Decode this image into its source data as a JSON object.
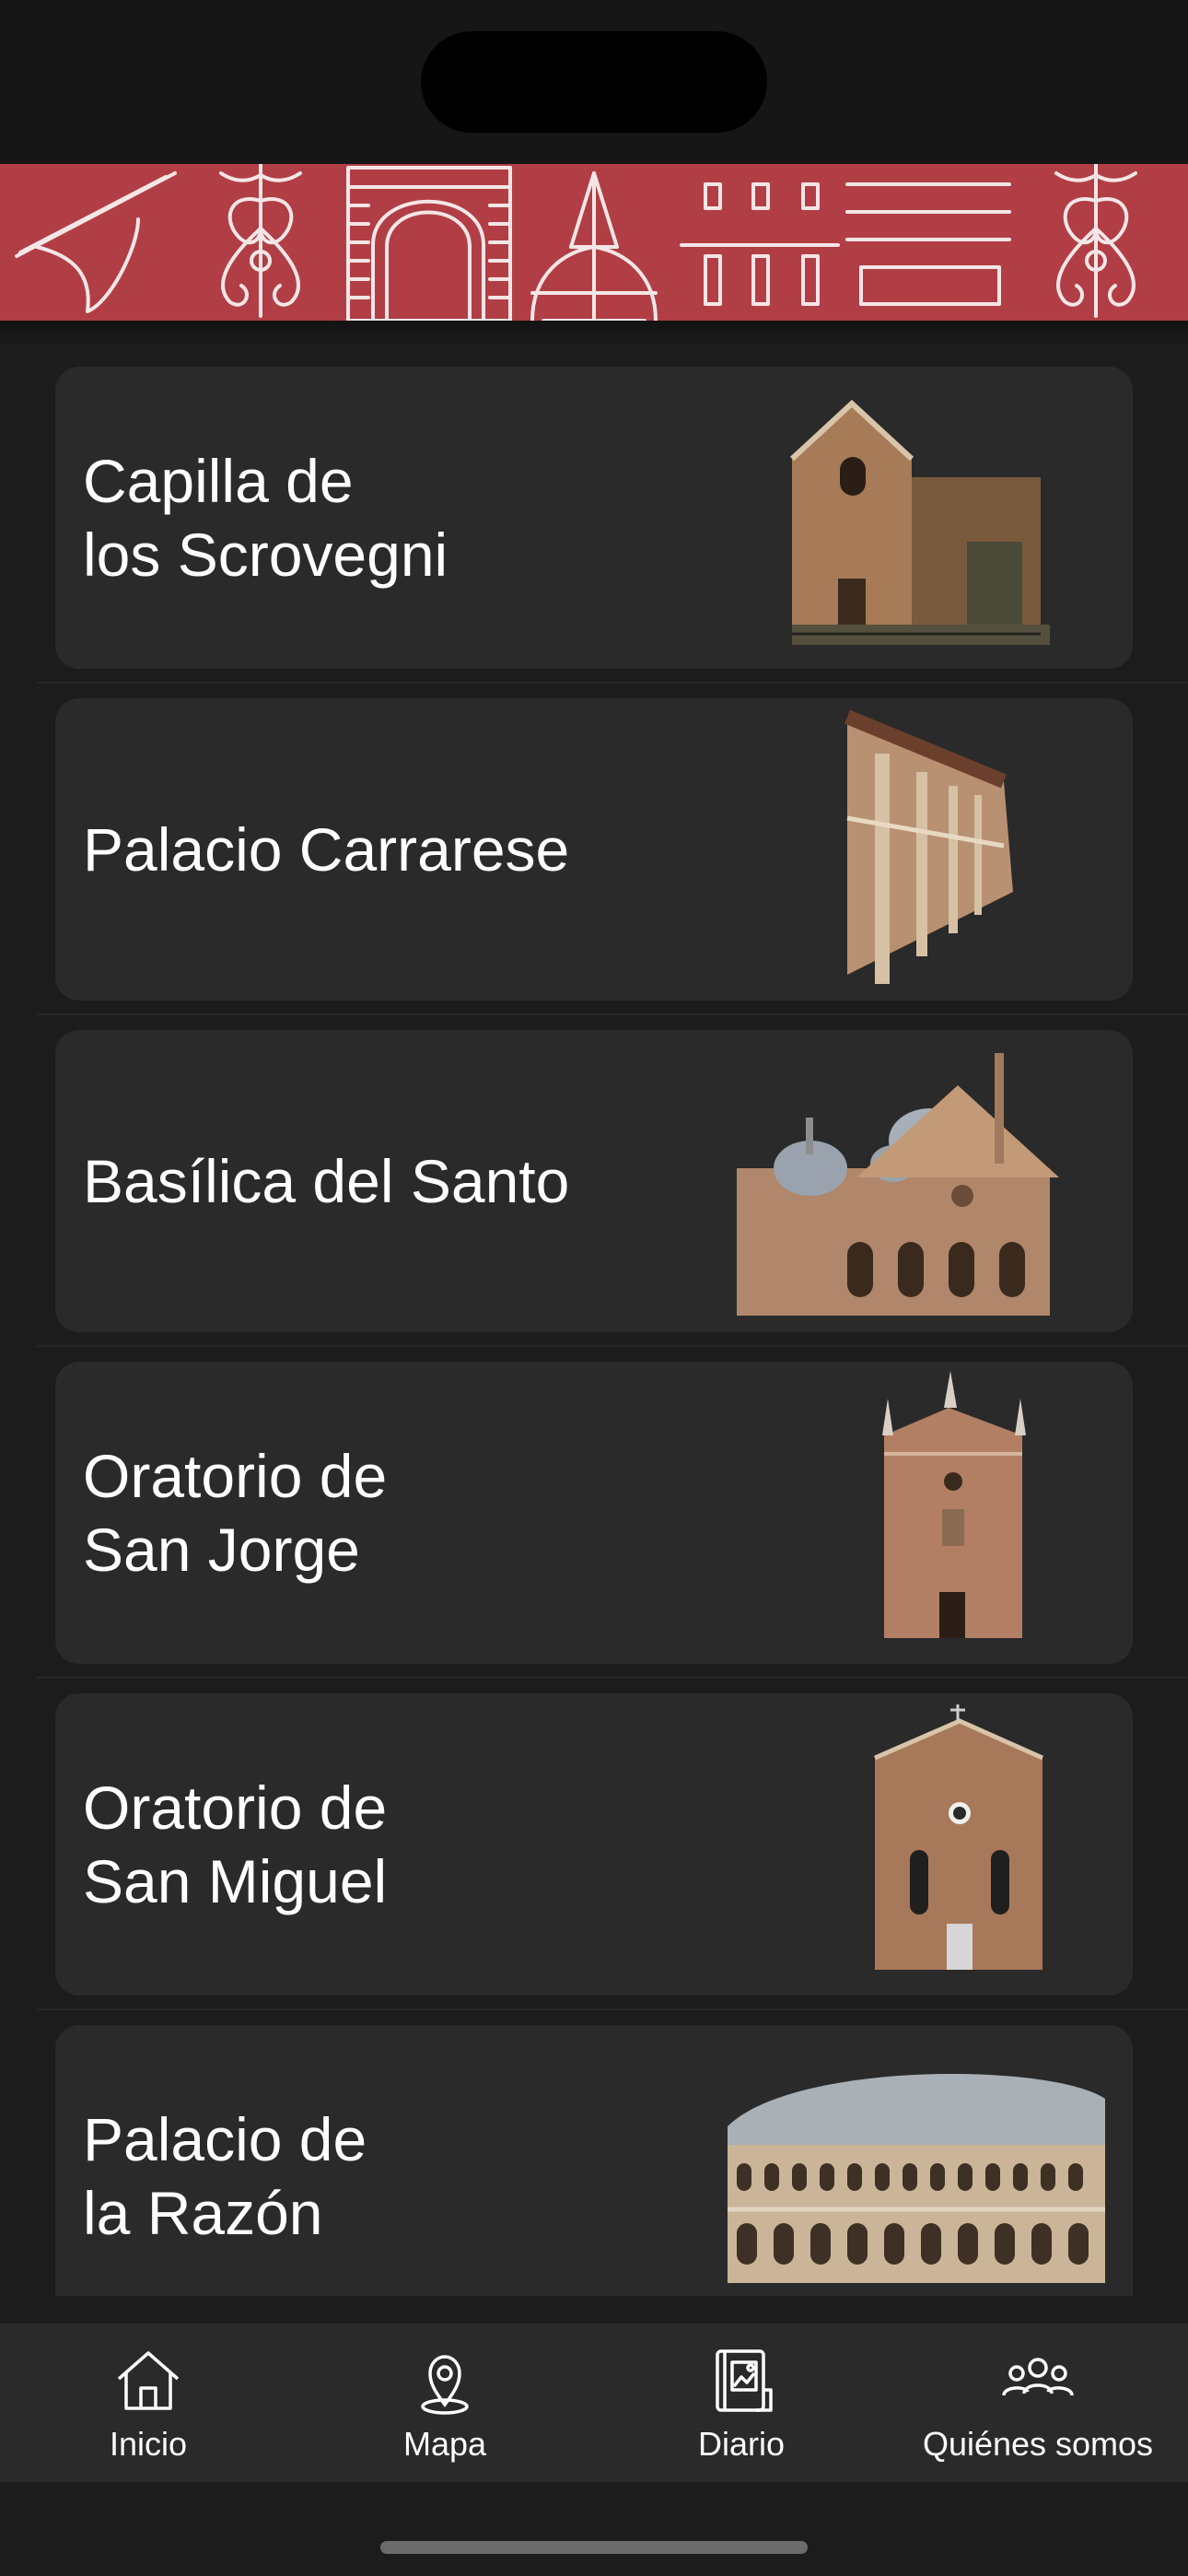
{
  "places": [
    {
      "title": "Capilla de\nlos Scrovegni",
      "image_icon": "scrovegni-chapel-photo"
    },
    {
      "title": "Palacio Carrarese",
      "image_icon": "palazzo-carrarese-photo"
    },
    {
      "title": "Basílica del Santo",
      "image_icon": "basilica-santo-photo"
    },
    {
      "title": "Oratorio de\nSan Jorge",
      "image_icon": "oratorio-san-giorgio-photo"
    },
    {
      "title": "Oratorio de\nSan Miguel",
      "image_icon": "oratorio-san-michele-photo"
    },
    {
      "title": "Palacio de\nla Razón",
      "image_icon": "palazzo-ragione-photo"
    }
  ],
  "tabbar": {
    "items": [
      {
        "label": "Inicio",
        "icon": "home-icon"
      },
      {
        "label": "Mapa",
        "icon": "map-pin-icon"
      },
      {
        "label": "Diario",
        "icon": "diary-icon"
      },
      {
        "label": "Quiénes somos",
        "icon": "group-icon"
      }
    ]
  },
  "colors": {
    "banner": "#b23e45",
    "background": "#1c1c1c",
    "card": "#2a2a2a",
    "text": "#ffffff"
  }
}
